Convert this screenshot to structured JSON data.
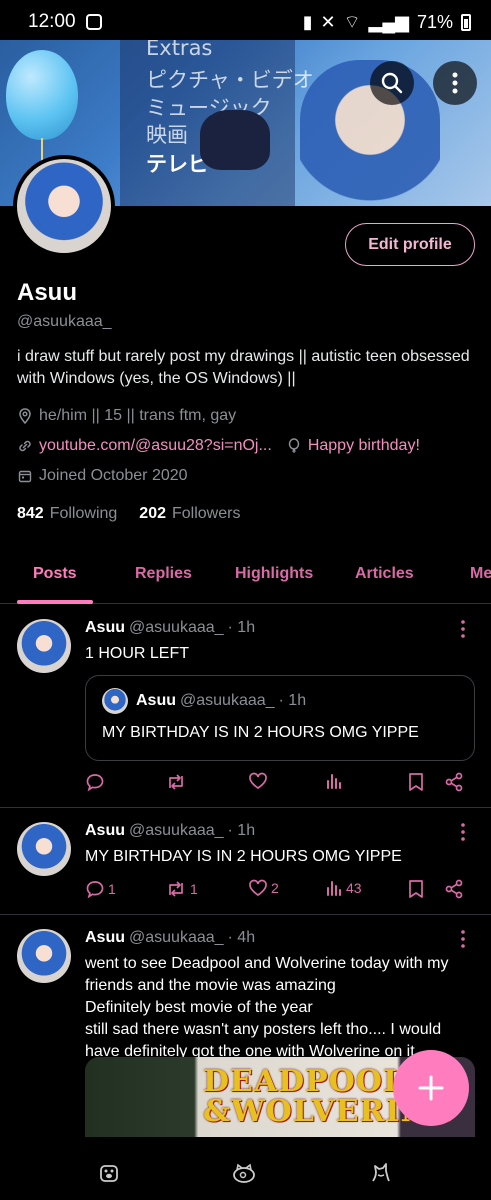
{
  "status_bar": {
    "time": "12:00",
    "battery": "71%"
  },
  "banner": {
    "menu_items": [
      "Extras",
      "ピクチャ・ビデオ",
      "ミュージック",
      "映画",
      "テレビ"
    ],
    "selected": "テレビ"
  },
  "profile": {
    "edit_label": "Edit profile",
    "name": "Asuu",
    "handle": "@asuukaaa_",
    "bio": "i draw stuff but rarely post my drawings || autistic teen obsessed with Windows (yes, the OS Windows) ||",
    "location": "he/him || 15 || trans ftm, gay",
    "link": "youtube.com/@asuu28?si=nOj...",
    "birthday": "Happy birthday!",
    "joined": "Joined October 2020",
    "following_count": "842",
    "following_label": "Following",
    "followers_count": "202",
    "followers_label": "Followers"
  },
  "tabs": [
    "Posts",
    "Replies",
    "Highlights",
    "Articles",
    "Me"
  ],
  "posts": [
    {
      "name": "Asuu",
      "handle": "@asuukaaa_",
      "time": "· 1h",
      "text": "1 HOUR LEFT",
      "quote": {
        "name": "Asuu",
        "handle": "@asuukaaa_",
        "time": "· 1h",
        "text": "MY BIRTHDAY IS IN 2 HOURS OMG YIPPE"
      },
      "stats": {
        "replies": "",
        "reposts": "",
        "likes": "",
        "views": ""
      }
    },
    {
      "name": "Asuu",
      "handle": "@asuukaaa_",
      "time": "· 1h",
      "text": "MY BIRTHDAY IS IN 2 HOURS OMG YIPPE",
      "stats": {
        "replies": "1",
        "reposts": "1",
        "likes": "2",
        "views": "43"
      }
    },
    {
      "name": "Asuu",
      "handle": "@asuukaaa_",
      "time": "· 4h",
      "text_lines": [
        "went to see Deadpool and Wolverine today with my",
        "friends and the movie was amazing",
        "Definitely best movie of the year",
        "still sad there wasn't any posters left tho.... I would",
        "have definitely got the one with Wolverine on it"
      ],
      "media_text": [
        "DEADPOOL",
        "&WOLVERINE"
      ]
    }
  ],
  "colors": {
    "accent": "#ff7dbf",
    "accent_dim": "#d86aa6",
    "background": "#000000",
    "muted": "#8b8f95"
  }
}
